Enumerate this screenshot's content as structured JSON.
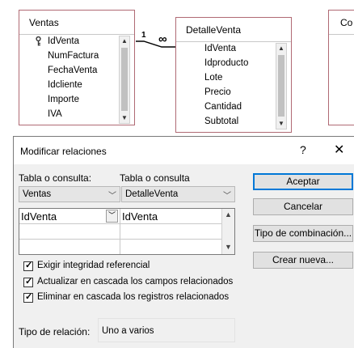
{
  "canvas": {
    "ventas": {
      "title": "Ventas",
      "fields": [
        "IdVenta",
        "NumFactura",
        "FechaVenta",
        "Idcliente",
        "Importe",
        "IVA"
      ]
    },
    "detalle": {
      "title": "DetalleVenta",
      "fields": [
        "IdVenta",
        "Idproducto",
        "Lote",
        "Precio",
        "Cantidad",
        "Subtotal"
      ]
    },
    "partial_title": "Co",
    "rel_one": "1",
    "rel_many": "∞"
  },
  "dialog": {
    "title": "Modificar relaciones",
    "help": "?",
    "close": "✕",
    "label_table_left": "Tabla o consulta:",
    "label_table_right": "Tabla o consulta",
    "combo_left": "Ventas",
    "combo_right": "DetalleVenta",
    "grid_left": "IdVenta",
    "grid_right": "IdVenta",
    "buttons": {
      "accept": "Aceptar",
      "cancel": "Cancelar",
      "join_type": "Tipo de combinación...",
      "new": "Crear nueva..."
    },
    "checkboxes": [
      {
        "label": "Exigir integridad referencial",
        "checked": true
      },
      {
        "label": "Actualizar en cascada los campos relacionados",
        "checked": true
      },
      {
        "label": "Eliminar en cascada los registros relacionados",
        "checked": true
      }
    ],
    "rel_type_label": "Tipo de relación:",
    "rel_type_value": "Uno a varios"
  }
}
